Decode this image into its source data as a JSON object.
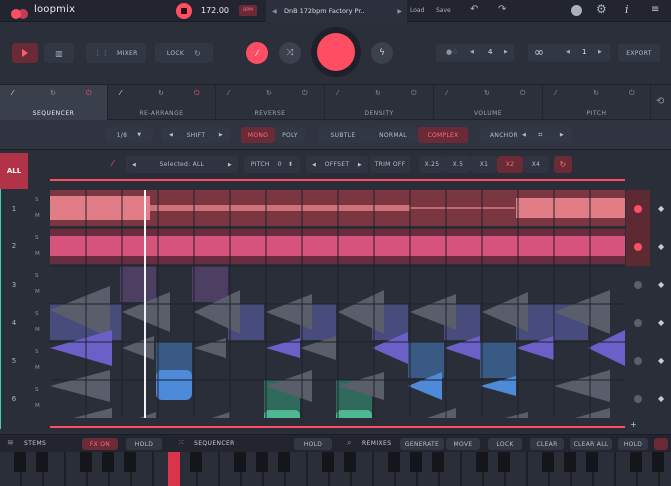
{
  "app": {
    "logo": "loopmix",
    "tempo": "172.00",
    "tempo_tag": "BPM",
    "preset_name": "DnB 172bpm Factory Pr..",
    "load_label": "Load",
    "save_label": "Save",
    "accent": "#ff4d64"
  },
  "transport": {
    "mixer_label": "MIXER",
    "lock_label": "LOCK",
    "bars_value": "4",
    "loop_value": "1",
    "export_label": "EXPORT"
  },
  "modules": [
    {
      "name": "SEQUENCER"
    },
    {
      "name": "RE-ARRANGE"
    },
    {
      "name": "REVERSE"
    },
    {
      "name": "DENSITY"
    },
    {
      "name": "VOLUME"
    },
    {
      "name": "PITCH"
    }
  ],
  "options": {
    "division": "1/8",
    "shift": "SHIFT",
    "mono": "MONO",
    "poly": "POLY",
    "subtle": "SUBTLE",
    "normal": "NORMAL",
    "complex": "COMPLEX",
    "anchor": "ANCHOR"
  },
  "trackbar": {
    "all_label": "ALL",
    "selected": "Selected: ALL",
    "pitch_label": "PITCH",
    "pitch_value": "0",
    "offset_label": "OFFSET",
    "trim_label": "TRIM OFF",
    "speeds": [
      "X.25",
      "X.5",
      "X1",
      "X2",
      "X4"
    ],
    "speed_active": "X2"
  },
  "tracks": [
    {
      "num": "1",
      "s": "S",
      "m": "M"
    },
    {
      "num": "2",
      "s": "S",
      "m": "M"
    },
    {
      "num": "3",
      "s": "S",
      "m": "M"
    },
    {
      "num": "4",
      "s": "S",
      "m": "M"
    },
    {
      "num": "5",
      "s": "S",
      "m": "M"
    },
    {
      "num": "6",
      "s": "S",
      "m": "M"
    }
  ],
  "bottom": {
    "stems": "STEMS",
    "fx_on": "FX ON",
    "hold1": "HOLD",
    "sequencer": "SEQUENCER",
    "hold2": "HOLD",
    "remixes": "REMIXES",
    "generate": "GENERATE",
    "move": "MOVE",
    "lock": "LOCK",
    "clear": "CLEAR",
    "clear_all": "CLEAR ALL",
    "hold3": "HOLD"
  }
}
